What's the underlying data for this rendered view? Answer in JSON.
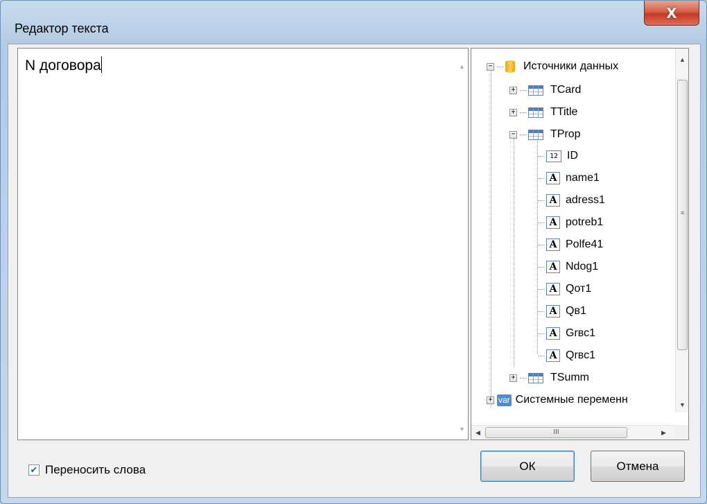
{
  "window": {
    "title": "Редактор текста",
    "close_label": "X"
  },
  "editor": {
    "text": "N договора"
  },
  "tree": {
    "root": {
      "label": "Источники данных",
      "expander": "−"
    },
    "tables": [
      {
        "label": "TCard",
        "expander": "+"
      },
      {
        "label": "TTitle",
        "expander": "+"
      },
      {
        "label": "TProp",
        "expander": "−"
      }
    ],
    "fields": [
      {
        "label": "ID",
        "type_icon": "12"
      },
      {
        "label": "name1",
        "type_icon": "A"
      },
      {
        "label": "adress1",
        "type_icon": "A"
      },
      {
        "label": "potreb1",
        "type_icon": "A"
      },
      {
        "label": "Polfe41",
        "type_icon": "A"
      },
      {
        "label": "Ndog1",
        "type_icon": "A"
      },
      {
        "label": "Qот1",
        "type_icon": "A"
      },
      {
        "label": "Qв1",
        "type_icon": "A"
      },
      {
        "label": "Grвс1",
        "type_icon": "A"
      },
      {
        "label": "Qrвс1",
        "type_icon": "A"
      }
    ],
    "after_table": {
      "label": "TSumm",
      "expander": "+"
    },
    "system": {
      "label": "Системные переменн",
      "expander": "+",
      "icon_text": "var"
    },
    "scroll_thumb_label": "III"
  },
  "word_wrap": {
    "label": "Переносить слова",
    "checked": "✔"
  },
  "buttons": {
    "ok": "ОК",
    "cancel": "Отмена"
  }
}
